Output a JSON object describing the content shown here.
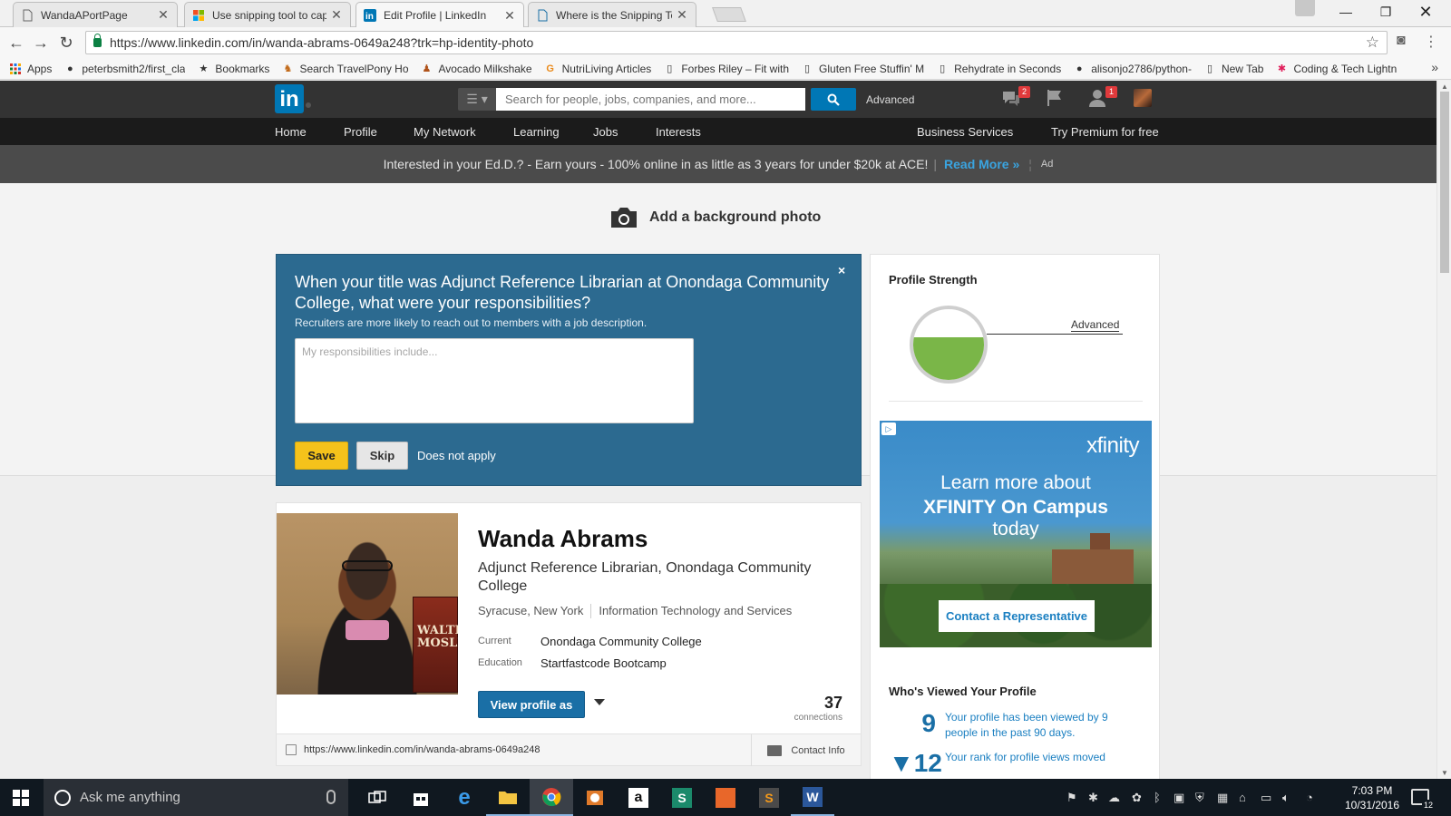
{
  "browser": {
    "tabs": [
      {
        "title": "WandaAPortPage",
        "icon": "page-icon"
      },
      {
        "title": "Use snipping tool to cap",
        "icon": "windows-logo-icon"
      },
      {
        "title": "Edit Profile | LinkedIn",
        "icon": "linkedin-icon",
        "active": true
      },
      {
        "title": "Where is the Snipping To",
        "icon": "page-icon"
      }
    ],
    "url": "https://www.linkedin.com/in/wanda-abrams-0649a248?trk=hp-identity-photo",
    "bookmarks": [
      {
        "label": "Apps",
        "icon": "apps-grid-icon"
      },
      {
        "label": "peterbsmith2/first_cla",
        "icon": "github-icon"
      },
      {
        "label": "Bookmarks",
        "icon": "star-icon"
      },
      {
        "label": "Search TravelPony Ho",
        "icon": "travelpony-icon"
      },
      {
        "label": "Avocado Milkshake",
        "icon": "avocado-icon"
      },
      {
        "label": "NutriLiving Articles",
        "icon": "google-icon"
      },
      {
        "label": "Forbes Riley – Fit with",
        "icon": "page-icon"
      },
      {
        "label": "Gluten Free Stuffin' M",
        "icon": "page-icon"
      },
      {
        "label": "Rehydrate in Seconds",
        "icon": "page-icon"
      },
      {
        "label": "alisonjo2786/python-",
        "icon": "github-icon"
      },
      {
        "label": "New Tab",
        "icon": "page-icon"
      },
      {
        "label": "Coding & Tech Lightn",
        "icon": "slack-icon"
      }
    ],
    "bookmarks_more": "»"
  },
  "linkedin": {
    "logo": "in",
    "search_placeholder": "Search for people, jobs, companies, and more...",
    "advanced": "Advanced",
    "messages_count": "2",
    "connections_count": "1",
    "nav": [
      "Home",
      "Profile",
      "My Network",
      "Learning",
      "Jobs",
      "Interests",
      "Business Services",
      "Try Premium for free"
    ],
    "ad_banner": {
      "text": "Interested in your Ed.D.? - Earn yours - 100% online in as little as 3 years for under $20k at ACE!",
      "sep": "|",
      "link": "Read More »",
      "tag": "Ad"
    },
    "add_background": "Add a background photo",
    "guided_edit": {
      "question": "When your title was Adjunct Reference Librarian at Onondaga Community College, what were your responsibilities?",
      "subtext": "Recruiters are more likely to reach out to members with a job description.",
      "placeholder": "My responsibilities include...",
      "save": "Save",
      "skip": "Skip",
      "not_apply": "Does not apply",
      "close": "×"
    },
    "profile": {
      "name": "Wanda Abrams",
      "headline": "Adjunct Reference Librarian, Onondaga Community College",
      "location": "Syracuse, New York",
      "industry": "Information Technology and Services",
      "current_label": "Current",
      "current": "Onondaga Community College",
      "education_label": "Education",
      "education": "Startfastcode Bootcamp",
      "book_text": "WALTE MOSLE",
      "view_as": "View profile as",
      "connections": "37",
      "connections_label": "connections",
      "public_url": "https://www.linkedin.com/in/wanda-abrams-0649a248",
      "contact": "Contact Info"
    },
    "strength": {
      "title": "Profile Strength",
      "level": "Advanced",
      "fill_fraction": 0.6
    },
    "xfinity_ad": {
      "brand": "xfinity",
      "line1": "Learn more about",
      "line2": "XFINITY On Campus",
      "line3": "today",
      "cta": "Contact a Representative"
    },
    "viewed": {
      "title": "Who's Viewed Your Profile",
      "items": [
        {
          "num": "9",
          "text": "Your profile has been viewed by 9 people in the past 90 days."
        },
        {
          "num": "▼12",
          "text": "Your rank for profile views moved"
        }
      ]
    }
  },
  "taskbar": {
    "search_placeholder": "Ask me anything",
    "time": "7:03 PM",
    "date": "10/31/2016",
    "notifications": "12"
  }
}
